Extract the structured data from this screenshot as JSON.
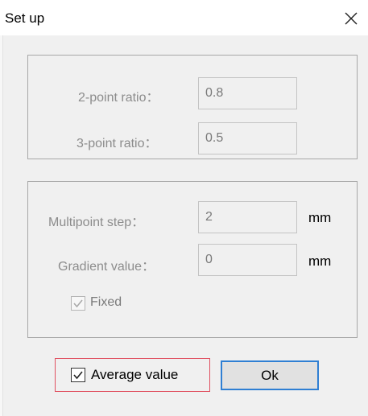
{
  "window": {
    "title": "Set up",
    "close_icon": "close-x-icon"
  },
  "ratio_group": {
    "two_point_label": "2-point ratio：",
    "two_point_value": "0.8",
    "three_point_label": "3-point ratio：",
    "three_point_value": "0.5"
  },
  "step_group": {
    "multipoint_label": "Multipoint step：",
    "multipoint_value": "2",
    "multipoint_unit": "mm",
    "gradient_label": "Gradient value：",
    "gradient_value": "0",
    "gradient_unit": "mm",
    "fixed_label": "Fixed",
    "fixed_checked": true,
    "fixed_enabled": false
  },
  "footer": {
    "average_label": "Average value",
    "average_checked": true,
    "ok_label": "Ok"
  },
  "colors": {
    "accent": "#2f7fd3",
    "highlight_border": "#e05060",
    "disabled_text": "#8c8c8c"
  }
}
